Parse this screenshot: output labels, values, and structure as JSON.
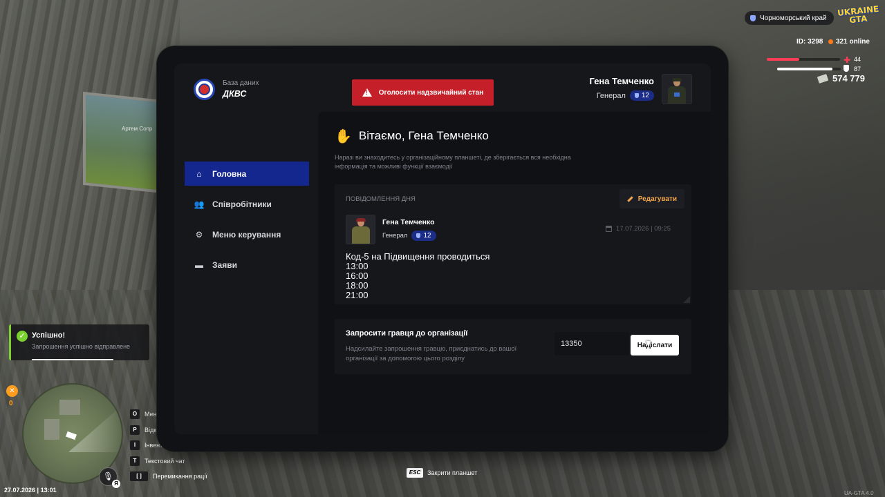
{
  "hud": {
    "region": "Чорноморський край",
    "logo_text": "UKRAINE GTA",
    "player_id": "ID: 3298",
    "online": "321 online",
    "health": 44,
    "health_value": "44",
    "armor": 87,
    "armor_value": "87",
    "money": "574 779",
    "hunger_value": "0",
    "mic_key": "Я",
    "datetime": "27.07.2026 | 13:01",
    "version": "UA-GTA 4.0",
    "world_label": "Артем Сопр",
    "colors": {
      "health": "#ff3d57",
      "armor": "#ffffff",
      "online_dot": "#ff7a1a"
    },
    "keybinds": [
      {
        "key": "O",
        "label": "Меню"
      },
      {
        "key": "P",
        "label": "Відк"
      },
      {
        "key": "I",
        "label": "Інвент"
      },
      {
        "key": "T",
        "label": "Текстовий чат"
      },
      {
        "key": "[ ]",
        "label": "Перемикання рації"
      }
    ],
    "esc_key": "ESC",
    "esc_label": "Закрити планшет"
  },
  "toast": {
    "title": "Успішно!",
    "text": "Запрошення успішно відправлене",
    "color": "#7bd12f"
  },
  "tablet": {
    "brand_subtitle": "База даних",
    "brand_title": "ДКВС",
    "alarm_button": "Оголосити надзвичайний стан",
    "alarm_color": "#c5202a",
    "user": {
      "name": "Гена Темченко",
      "rank": "Генерал",
      "level": "12"
    },
    "nav": [
      {
        "label": "Головна",
        "icon": "home-icon",
        "active": true
      },
      {
        "label": "Співробітники",
        "icon": "users-icon",
        "active": false
      },
      {
        "label": "Меню керування",
        "icon": "gear-icon",
        "active": false
      },
      {
        "label": "Заяви",
        "icon": "folder-icon",
        "active": false
      }
    ],
    "accent_color": "#13278f",
    "greeting": "Вітаємо, Гена Темченко",
    "greeting_text": "Наразі ви знаходитесь у організаційному планшеті, де зберігається вся необхідна інформація та можливі функції взаємодії",
    "motd": {
      "label": "ПОВІДОМЛЕННЯ ДНЯ",
      "edit_label": "Редагувати",
      "author": "Гена Темченко",
      "author_rank": "Генерал",
      "author_level": "12",
      "date": "17.07.2026 | 09:25",
      "body": "Код-5 на Підвищення проводиться\n13:00\n16:00\n18:00\n21:00"
    },
    "invite": {
      "title": "Запросити гравця до організації",
      "text": "Надсилайте запрошення гравцю, приєднатись до вашої організації за допомогою цього розділу",
      "input_value": "13350",
      "button": "Надіслати"
    }
  }
}
